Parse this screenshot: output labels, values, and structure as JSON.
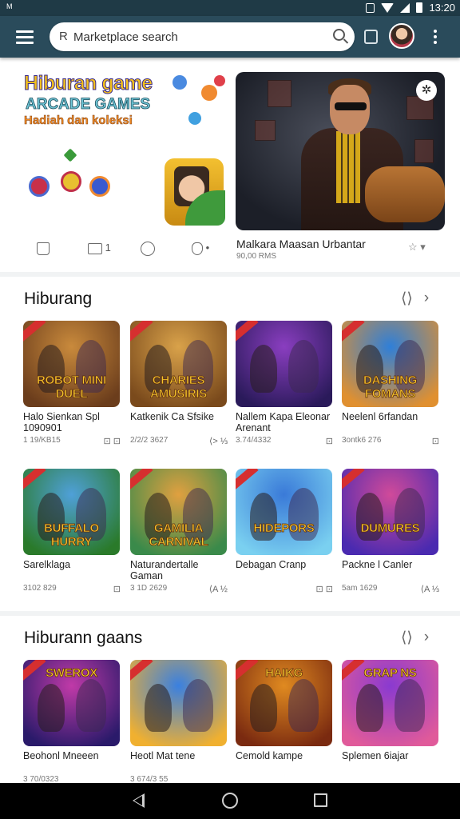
{
  "status_bar": {
    "left_indicator": "M",
    "time": "13:20"
  },
  "search": {
    "value": "Marketplace search"
  },
  "hero": {
    "promo_line1": "Hiburan game",
    "promo_line2": "ARCADE GAMES",
    "promo_line3": "Hadiah dan koleksi",
    "game_title": "Malkara Maasan Urbantar",
    "game_subtitle": "90,00 RMS",
    "badge": "✲",
    "actions": {
      "like": "",
      "comments": "1",
      "share": "",
      "more": "•"
    },
    "rating_label": "☆ ▾"
  },
  "sections": [
    {
      "title": "Hiburang",
      "items": [
        {
          "name": "Halo Sienkan Spl 1090901",
          "meta": "1 19/KB15",
          "badge": "⊡ ⊡",
          "logo": "ROBOT MINI DUEL",
          "palette": [
            "#c98a3c",
            "#6b3d1c"
          ]
        },
        {
          "name": "Katkenik Ca Sfsike",
          "meta": "2/2/2 3627",
          "badge": "⟨> ⅓",
          "logo": "CHARIES AMUSIRIS",
          "palette": [
            "#d9a24a",
            "#7a4a1c"
          ]
        },
        {
          "name": "Nallem Kapa Eleonar Arenant",
          "meta": "3.74/4332",
          "badge": "⊡",
          "logo": "",
          "palette": [
            "#8a3ec0",
            "#2a1a5a"
          ]
        },
        {
          "name": "Neelenl 6rfandan",
          "meta": "3ontk6 276",
          "badge": "⊡",
          "logo": "DASHING FOMANS",
          "palette": [
            "#2f7fd8",
            "#e09030"
          ]
        }
      ]
    },
    {
      "title": "",
      "items": [
        {
          "name": "Sarelklaga",
          "meta": "3102 829",
          "badge": "⊡",
          "logo": "BUFFALO HURRY",
          "palette": [
            "#4fa0d8",
            "#2a7a2a"
          ]
        },
        {
          "name": "Naturandertalle Gaman",
          "meta": "3 1D 2629",
          "badge": "⟨A ½",
          "logo": "GAMILIA CARNIVAL",
          "palette": [
            "#e0a040",
            "#3a8a4a"
          ]
        },
        {
          "name": "Debagan Cranp",
          "meta": "",
          "badge": "⊡ ⊡",
          "logo": "HIDEPORS",
          "palette": [
            "#3a7ad8",
            "#7ad0f0"
          ]
        },
        {
          "name": "Packne l Canler",
          "meta": "5am 1629",
          "badge": "⟨A ⅓",
          "logo": "DUMURES",
          "palette": [
            "#d04a9a",
            "#4a2ab0"
          ]
        }
      ]
    },
    {
      "title": "Hiburann gaans",
      "items": [
        {
          "name": "Beohonl Mneeen",
          "meta": "3 70/0323",
          "badge": "",
          "logo": "SWEROX",
          "palette": [
            "#c03aa8",
            "#2a1a6a"
          ]
        },
        {
          "name": "Heotl Mat tene",
          "meta": "3 674/3 55",
          "badge": "",
          "logo": "",
          "palette": [
            "#3a80e0",
            "#f0b030"
          ]
        },
        {
          "name": "Cemold kampe",
          "meta": "",
          "badge": "",
          "logo": "HAIKG",
          "palette": [
            "#e08a20",
            "#7a2a10"
          ]
        },
        {
          "name": "Splemen 6iajar",
          "meta": "",
          "badge": "",
          "logo": "GRAP NS",
          "palette": [
            "#8a3ad0",
            "#e05a9a"
          ]
        }
      ]
    }
  ]
}
